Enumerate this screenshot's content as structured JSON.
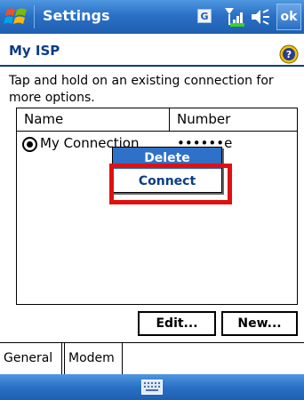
{
  "titlebar": {
    "title": "Settings",
    "g_badge": "G",
    "ok_label": "ok",
    "icons": [
      "windows-start-icon",
      "signal-icon",
      "volume-icon"
    ]
  },
  "header": {
    "title": "My ISP",
    "help_icon": "help-icon"
  },
  "instructions": "Tap and hold on an existing connection for more options.",
  "list": {
    "columns": [
      "Name",
      "Number"
    ],
    "rows": [
      {
        "name": "My Connection",
        "number": "••••••e",
        "selected": true
      }
    ]
  },
  "context_menu": {
    "items": [
      "Delete",
      "Connect"
    ],
    "highlighted": "Delete",
    "annotated": "Connect"
  },
  "buttons": {
    "edit": "Edit...",
    "new": "New..."
  },
  "tabs": [
    {
      "label": "General",
      "active": false
    },
    {
      "label": "Modem",
      "active": true
    }
  ],
  "menubar": {
    "input_icon": "keyboard-icon"
  },
  "colors": {
    "titlebar": "#2a70c6",
    "header_text": "#0b3c87",
    "menu_highlight": "#2f70c8",
    "annotation": "#e01010"
  }
}
